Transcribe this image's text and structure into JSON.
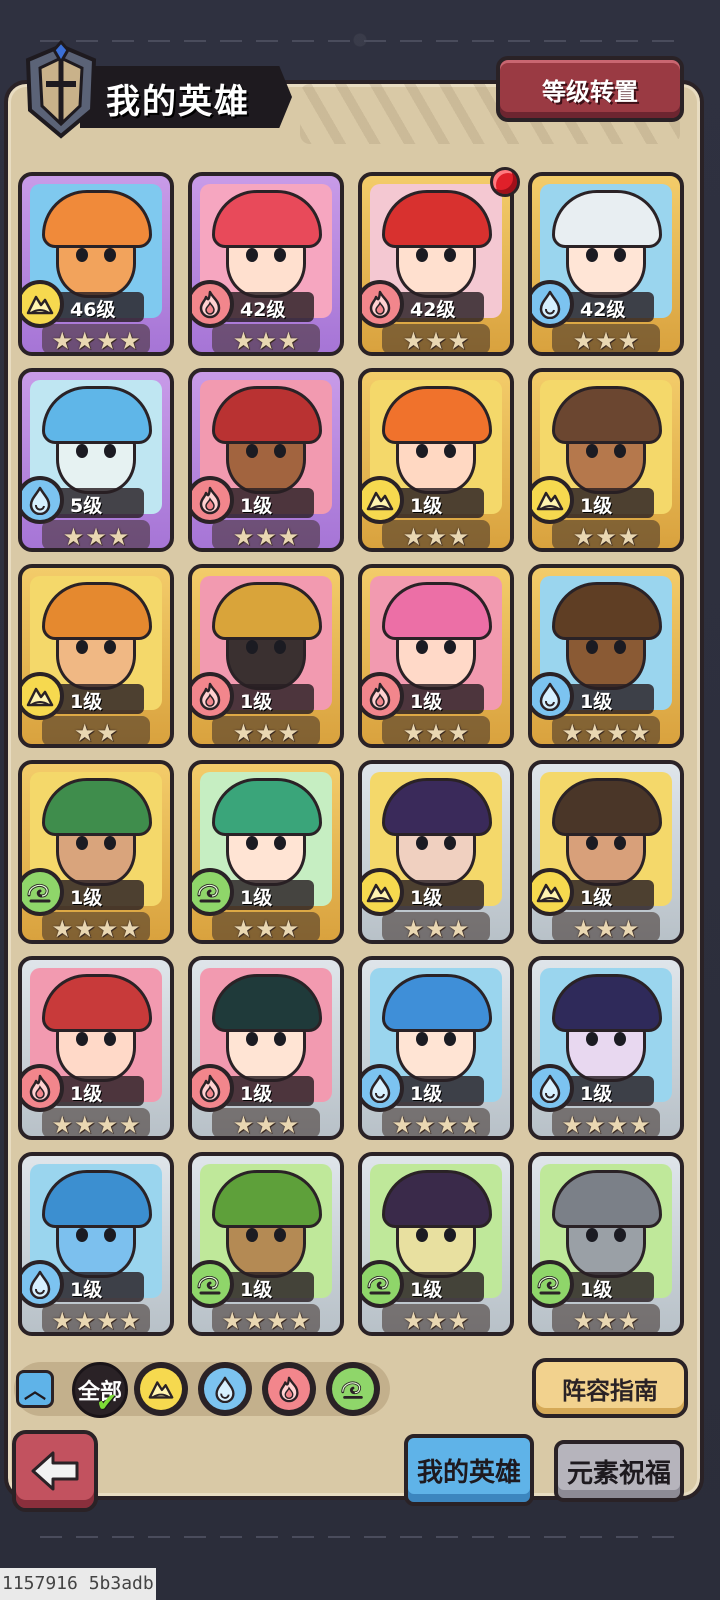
{
  "header": {
    "title": "我的英雄",
    "reset_label": "等级转置"
  },
  "heroes": [
    {
      "level": "46级",
      "element": "earth",
      "stars": 4,
      "rarity": "purple",
      "skin": "#f2a35c",
      "hair": "#f08a3a",
      "bg": "#7fc9ef"
    },
    {
      "level": "42级",
      "element": "fire",
      "stars": 3,
      "rarity": "purple",
      "skin": "#ffe0cf",
      "hair": "#e84a5a",
      "bg": "#f6a6c0"
    },
    {
      "level": "42级",
      "element": "fire",
      "stars": 3,
      "rarity": "gold",
      "skin": "#ffe0cf",
      "hair": "#d8312f",
      "bg": "#f4c8d2"
    },
    {
      "level": "42级",
      "element": "water",
      "stars": 3,
      "rarity": "gold",
      "skin": "#ffe5d6",
      "hair": "#e8eef2",
      "bg": "#9ad5ee"
    },
    {
      "level": "5级",
      "element": "water",
      "stars": 3,
      "rarity": "purple",
      "skin": "#e6f2f2",
      "hair": "#5fb6e8",
      "bg": "#bfe6f2"
    },
    {
      "level": "1级",
      "element": "fire",
      "stars": 3,
      "rarity": "purple",
      "skin": "#a2643f",
      "hair": "#b93232",
      "bg": "#f29ab0"
    },
    {
      "level": "1级",
      "element": "earth",
      "stars": 3,
      "rarity": "gold",
      "skin": "#ffd8c2",
      "hair": "#f0722c",
      "bg": "#f4d86a"
    },
    {
      "level": "1级",
      "element": "earth",
      "stars": 3,
      "rarity": "gold",
      "skin": "#b5784c",
      "hair": "#6b4630",
      "bg": "#f4d86a"
    },
    {
      "level": "1级",
      "element": "earth",
      "stars": 2,
      "rarity": "gold",
      "skin": "#f0b884",
      "hair": "#e5892f",
      "bg": "#f4d86a"
    },
    {
      "level": "1级",
      "element": "fire",
      "stars": 3,
      "rarity": "gold",
      "skin": "#3a3030",
      "hair": "#d9a43a",
      "bg": "#f29ab0"
    },
    {
      "level": "1级",
      "element": "fire",
      "stars": 3,
      "rarity": "gold",
      "skin": "#ffd9c8",
      "hair": "#ec6fa6",
      "bg": "#f29ab0"
    },
    {
      "level": "1级",
      "element": "water",
      "stars": 4,
      "rarity": "gold",
      "skin": "#8a5a34",
      "hair": "#5f3e24",
      "bg": "#9ad5ee"
    },
    {
      "level": "1级",
      "element": "wind",
      "stars": 4,
      "rarity": "gold",
      "skin": "#d9a47c",
      "hair": "#3f8d4c",
      "bg": "#f4d86a"
    },
    {
      "level": "1级",
      "element": "wind",
      "stars": 3,
      "rarity": "gold",
      "skin": "#ffe4d4",
      "hair": "#3aa57a",
      "bg": "#c6eec2"
    },
    {
      "level": "1级",
      "element": "earth",
      "stars": 3,
      "rarity": "silver",
      "skin": "#f0d0c0",
      "hair": "#3a2a5a",
      "bg": "#f4d86a"
    },
    {
      "level": "1级",
      "element": "earth",
      "stars": 3,
      "rarity": "silver",
      "skin": "#d8a07a",
      "hair": "#4a3628",
      "bg": "#f4d86a"
    },
    {
      "level": "1级",
      "element": "fire",
      "stars": 4,
      "rarity": "silver",
      "skin": "#ffd9c8",
      "hair": "#c83a3a",
      "bg": "#f29ab0"
    },
    {
      "level": "1级",
      "element": "fire",
      "stars": 3,
      "rarity": "silver",
      "skin": "#ffe4d4",
      "hair": "#1f3a3a",
      "bg": "#f29ab0"
    },
    {
      "level": "1级",
      "element": "water",
      "stars": 4,
      "rarity": "silver",
      "skin": "#ffe4d4",
      "hair": "#3f8fd8",
      "bg": "#9ad5ee"
    },
    {
      "level": "1级",
      "element": "water",
      "stars": 4,
      "rarity": "silver",
      "skin": "#e8d8f0",
      "hair": "#2f2a5a",
      "bg": "#9ad5ee"
    },
    {
      "level": "1级",
      "element": "water",
      "stars": 4,
      "rarity": "silver",
      "skin": "#7cc0ee",
      "hair": "#3c8fd0",
      "bg": "#9ad5ee"
    },
    {
      "level": "1级",
      "element": "wind",
      "stars": 4,
      "rarity": "silver",
      "skin": "#b48a54",
      "hair": "#5ea03a",
      "bg": "#bfe89a"
    },
    {
      "level": "1级",
      "element": "wind",
      "stars": 3,
      "rarity": "silver",
      "skin": "#e8e0a0",
      "hair": "#3a2a4a",
      "bg": "#bfe89a"
    },
    {
      "level": "1级",
      "element": "wind",
      "stars": 3,
      "rarity": "silver",
      "skin": "#9aa0a6",
      "hair": "#7b8088",
      "bg": "#bfe89a"
    }
  ],
  "filters": {
    "all_label": "全部",
    "elements": [
      "earth",
      "water",
      "fire",
      "wind"
    ]
  },
  "guide_label": "阵容指南",
  "tabs": {
    "my_heroes": "我的英雄",
    "element_blessing": "元素祝福"
  },
  "debug_text": "1157916 5b3adb",
  "colors": {
    "earth": "#f6d94f",
    "fire": "#f2868c",
    "water": "#7cc3f0",
    "wind": "#8fd66a"
  },
  "icons": {
    "collapse": "chevron-up-icon",
    "back": "back-arrow-icon",
    "title": "helmet-icon"
  }
}
